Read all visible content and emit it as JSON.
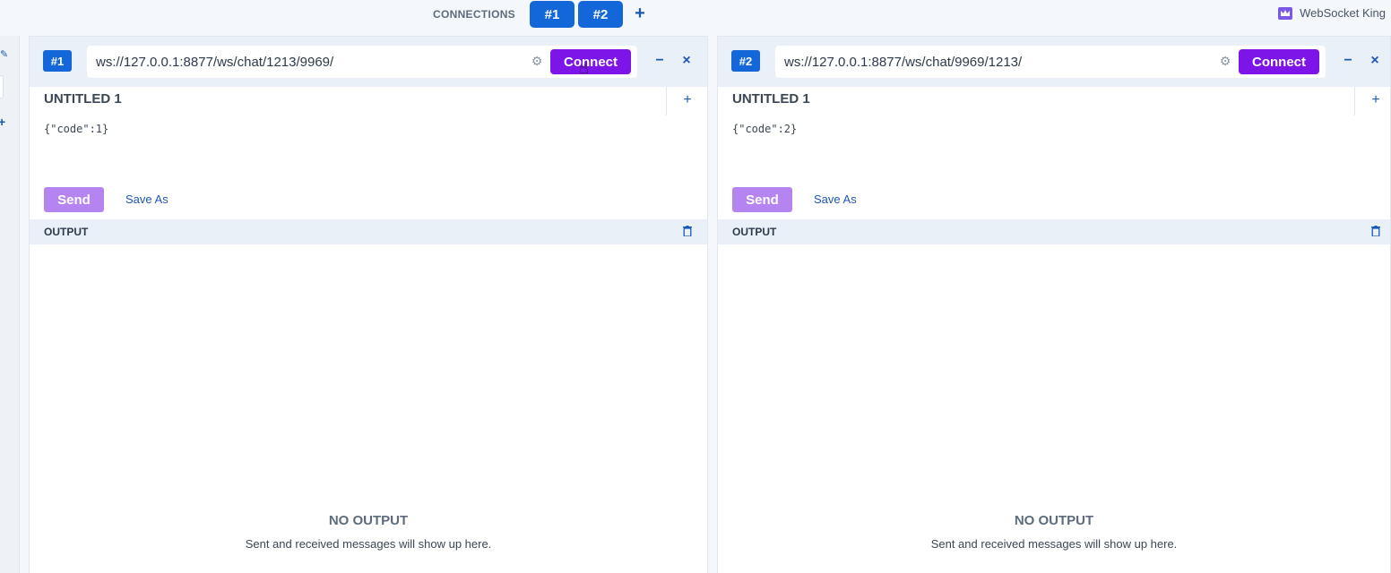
{
  "topbar": {
    "connections_label": "CONNECTIONS",
    "tabs": [
      "#1",
      "#2"
    ],
    "add_label": "+",
    "brand": "WebSocket King"
  },
  "panels": [
    {
      "badge": "#1",
      "url": "ws://127.0.0.1:8877/ws/chat/1213/9969/",
      "connect_label": "Connect",
      "minimize": "−",
      "close": "×",
      "message_title": "UNTITLED 1",
      "message_add": "+",
      "message_body": "{\"code\":1}",
      "send_label": "Send",
      "save_as_label": "Save As",
      "output_title": "OUTPUT",
      "empty_title": "NO OUTPUT",
      "empty_sub": "Sent and received messages will show up here."
    },
    {
      "badge": "#2",
      "url": "ws://127.0.0.1:8877/ws/chat/9969/1213/",
      "connect_label": "Connect",
      "minimize": "−",
      "close": "×",
      "message_title": "UNTITLED 1",
      "message_add": "+",
      "message_body": "{\"code\":2}",
      "send_label": "Send",
      "save_as_label": "Save As",
      "output_title": "OUTPUT",
      "empty_title": "NO OUTPUT",
      "empty_sub": "Sent and received messages will show up here."
    }
  ],
  "colors": {
    "accent": "#1467d8",
    "connect": "#7d14e8",
    "send_disabled": "#b684f0"
  }
}
